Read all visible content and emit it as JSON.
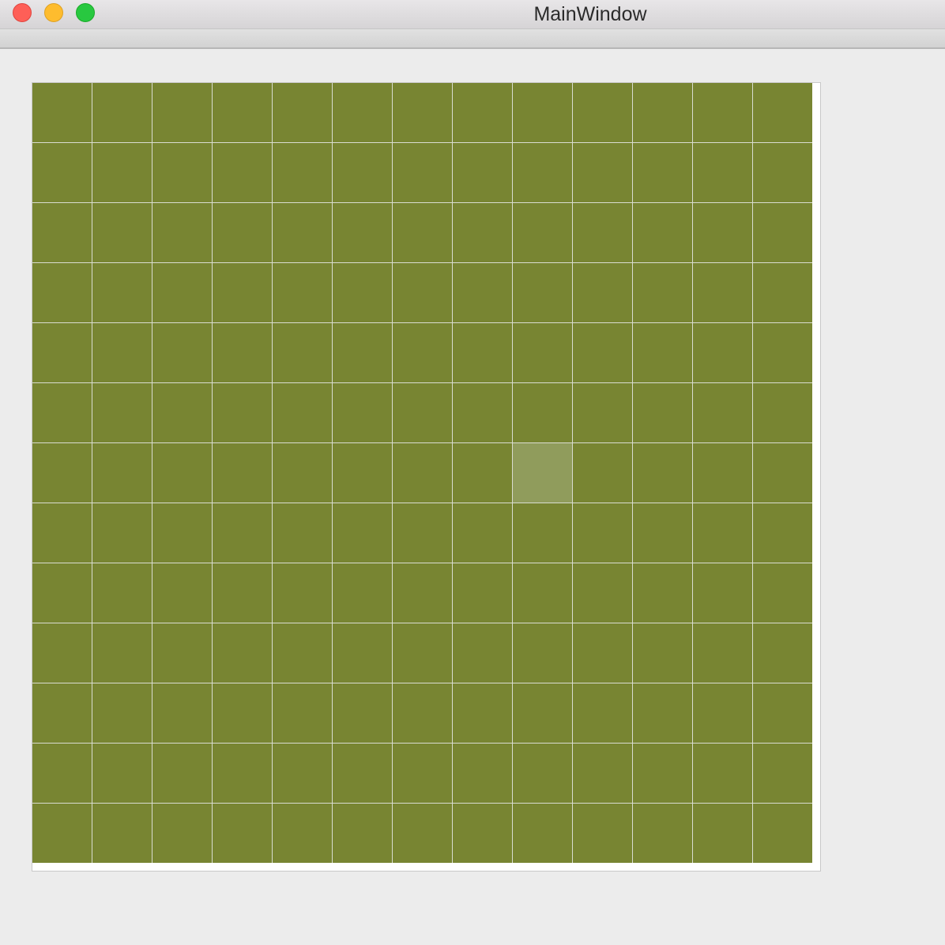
{
  "window": {
    "title": "MainWindow"
  },
  "colors": {
    "cell": "#788532",
    "cell_highlight": "#909c5c",
    "grid_line": "#d9dcd0"
  },
  "grid": {
    "rows": 13,
    "cols": 13,
    "highlighted_cell": {
      "row": 6,
      "col": 8
    }
  }
}
